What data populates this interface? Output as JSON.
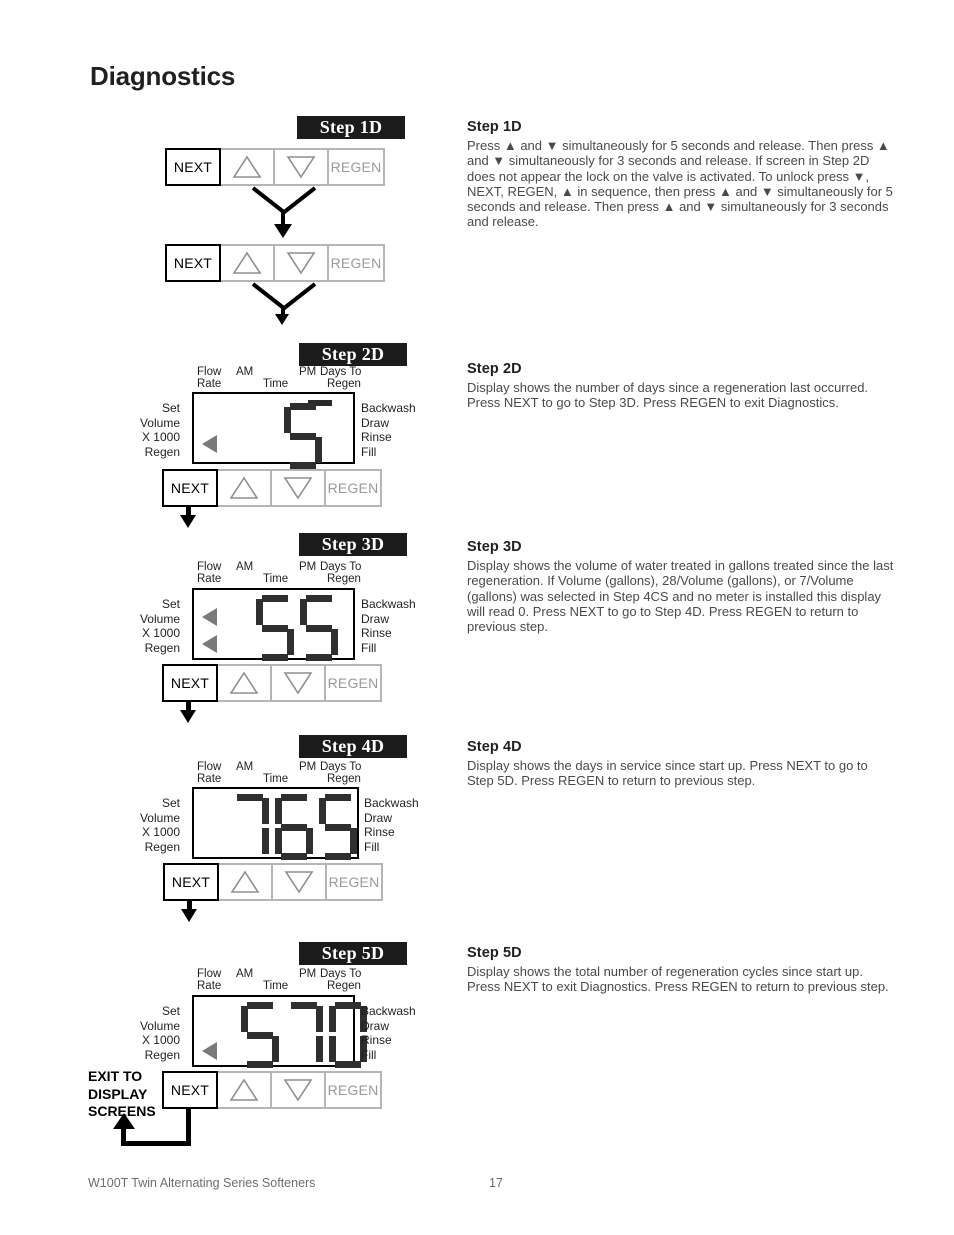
{
  "page": {
    "title": "Diagnostics",
    "footer_left": "W100T Twin Alternating Series Softeners",
    "footer_page": "17"
  },
  "keypad": {
    "next": "NEXT",
    "up": "△",
    "down": "▽",
    "regen": "REGEN"
  },
  "display_labels": {
    "flow": "Flow",
    "rate": "Rate",
    "am": "AM",
    "time": "Time",
    "pm": "PM",
    "days_to": "Days To",
    "regen_top": "Regen",
    "set": "Set",
    "volume": "Volume",
    "x1000": "X 1000",
    "regen_left": "Regen",
    "backwash": "Backwash",
    "draw": "Draw",
    "rinse": "Rinse",
    "fill": "Fill"
  },
  "exit_note": {
    "line1": "EXIT TO",
    "line2": "DISPLAY",
    "line3": "SCREENS"
  },
  "steps": [
    {
      "id": "1d",
      "badge": "Step 1D",
      "heading": "Step 1D",
      "body": "Press ▲ and ▼ simultaneously for 5 seconds and release. Then press ▲ and ▼ simultaneously for 3 seconds and release.  If screen in Step 2D does not appear the lock on the valve is activated. To unlock press ▼, NEXT, REGEN, ▲ in sequence, then press ▲ and ▼ simultaneously for 5 seconds and release. Then press ▲ and ▼ simultaneously for 3 seconds and release.",
      "display_value": null
    },
    {
      "id": "2d",
      "badge": "Step 2D",
      "heading": "Step 2D",
      "body": "Display shows the number of days since a regeneration last occurred. Press NEXT to go to Step 3D. Press REGEN to exit Diagnostics.",
      "display_value": "5",
      "indicators": [
        "regen"
      ],
      "days_dash": true
    },
    {
      "id": "3d",
      "badge": "Step 3D",
      "heading": "Step 3D",
      "body": "Display shows the volume of water treated in gallons treated since the last regeneration. If Volume (gallons), 28/Volume (gallons), or 7/Volume (gallons) was selected in Step 4CS and no meter is installed this display will read 0. Press NEXT to go to Step 4D. Press REGEN to return to previous step.",
      "display_value": "55",
      "indicators": [
        "volume",
        "regen"
      ],
      "days_dash": false
    },
    {
      "id": "4d",
      "badge": "Step 4D",
      "heading": "Step 4D",
      "body": "Display shows the days in service since start up. Press NEXT to go to Step 5D. Press REGEN to return to previous step.",
      "display_value": "765",
      "indicators": [],
      "days_dash": false
    },
    {
      "id": "5d",
      "badge": "Step 5D",
      "heading": "Step 5D",
      "body": "Display shows the total number of regeneration cycles since start up. Press NEXT to exit Diagnostics. Press REGEN to return to previous step.",
      "display_value": "570",
      "indicators": [
        "regen"
      ],
      "days_dash": false
    }
  ]
}
